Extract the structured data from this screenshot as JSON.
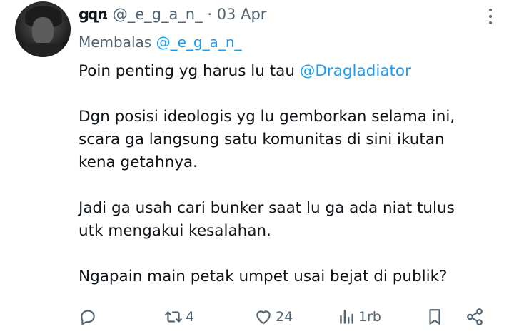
{
  "author": {
    "display_name": "ցզռ",
    "handle": "@_e_g_a_n_",
    "separator": "·",
    "date": "03 Apr"
  },
  "reply": {
    "label": "Membalas",
    "mention": "@_e_g_a_n_"
  },
  "tweet": {
    "line1_text": "Poin penting yg harus lu tau ",
    "line1_mention": "@Dragladiator",
    "para2_lines": [
      "Dgn posisi ideologis yg lu gemborkan selama ini,",
      "scara ga langsung satu komunitas di sini ikutan",
      "kena getahnya."
    ],
    "para3_lines": [
      "Jadi ga usah cari bunker saat lu ga ada niat tulus",
      "utk mengakui kesalahan."
    ],
    "para4_lines": [
      "Ngapain main petak umpet usai bejat di publik?"
    ]
  },
  "actions": {
    "reply_icon": "reply-icon",
    "retweet_count": "4",
    "like_count": "24",
    "views_count": "1rb",
    "bookmark_icon": "bookmark-icon",
    "share_icon": "share-icon"
  },
  "colors": {
    "text": "#0f1419",
    "secondary": "#536471",
    "accent": "#1d9bf0"
  }
}
